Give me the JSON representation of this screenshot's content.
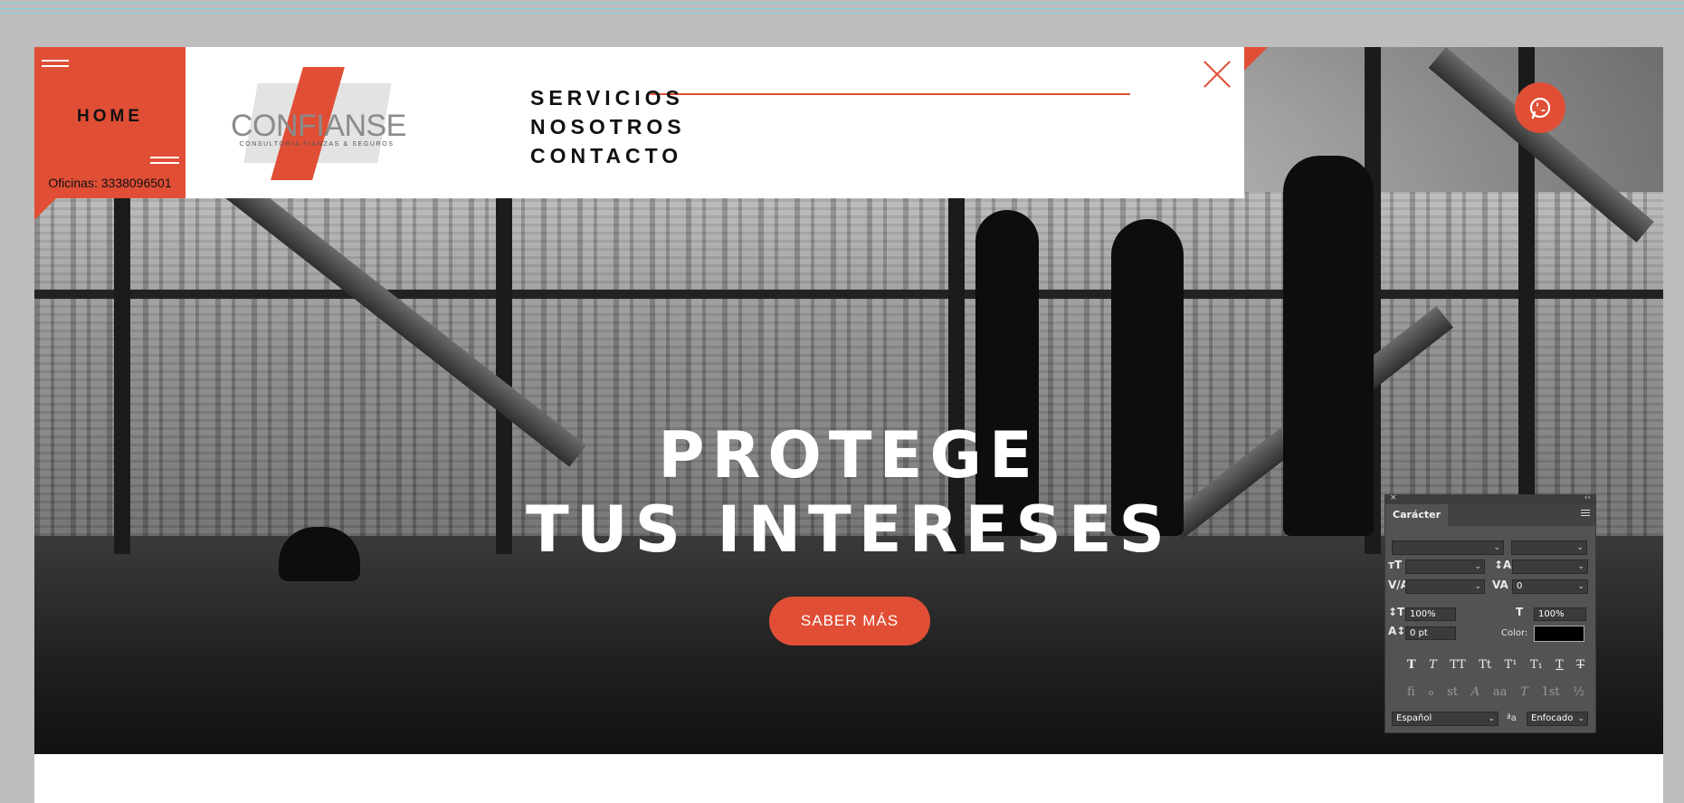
{
  "header": {
    "home_label": "HOME",
    "phone": "Oficinas: 3338096501",
    "logo_word": "CONFIANSE",
    "logo_sub": "CONSULTORÍA FIANZAS & SEGUROS"
  },
  "menu": {
    "items": [
      "SERVICIOS",
      "NOSOTROS",
      "CONTACTO"
    ]
  },
  "hero": {
    "title_line1": "PROTEGE",
    "title_line2": "TUS INTERESES",
    "cta_label": "SABER MÁS"
  },
  "character_panel": {
    "tab_label": "Carácter",
    "vertical_scale": "100%",
    "horizontal_scale": "100%",
    "tracking": "0",
    "baseline_shift": "0 pt",
    "color_label": "Color:",
    "language": "Español",
    "antialias_glyph": "ªa",
    "antialias": "Enfocado",
    "format_buttons": [
      "T",
      "T",
      "TT",
      "Tt",
      "T¹",
      "T₁",
      "T",
      "T"
    ],
    "opentype_buttons": [
      "fi",
      "ℴ",
      "st",
      "A",
      "aa",
      "T",
      "1st",
      "½"
    ]
  },
  "colors": {
    "accent": "#e04e35",
    "canvas": "#bdbdbd",
    "panel_bg": "#535353"
  },
  "icons": {
    "whatsapp": "whatsapp-icon",
    "close": "close-icon",
    "hamburger": "hamburger-icon"
  }
}
